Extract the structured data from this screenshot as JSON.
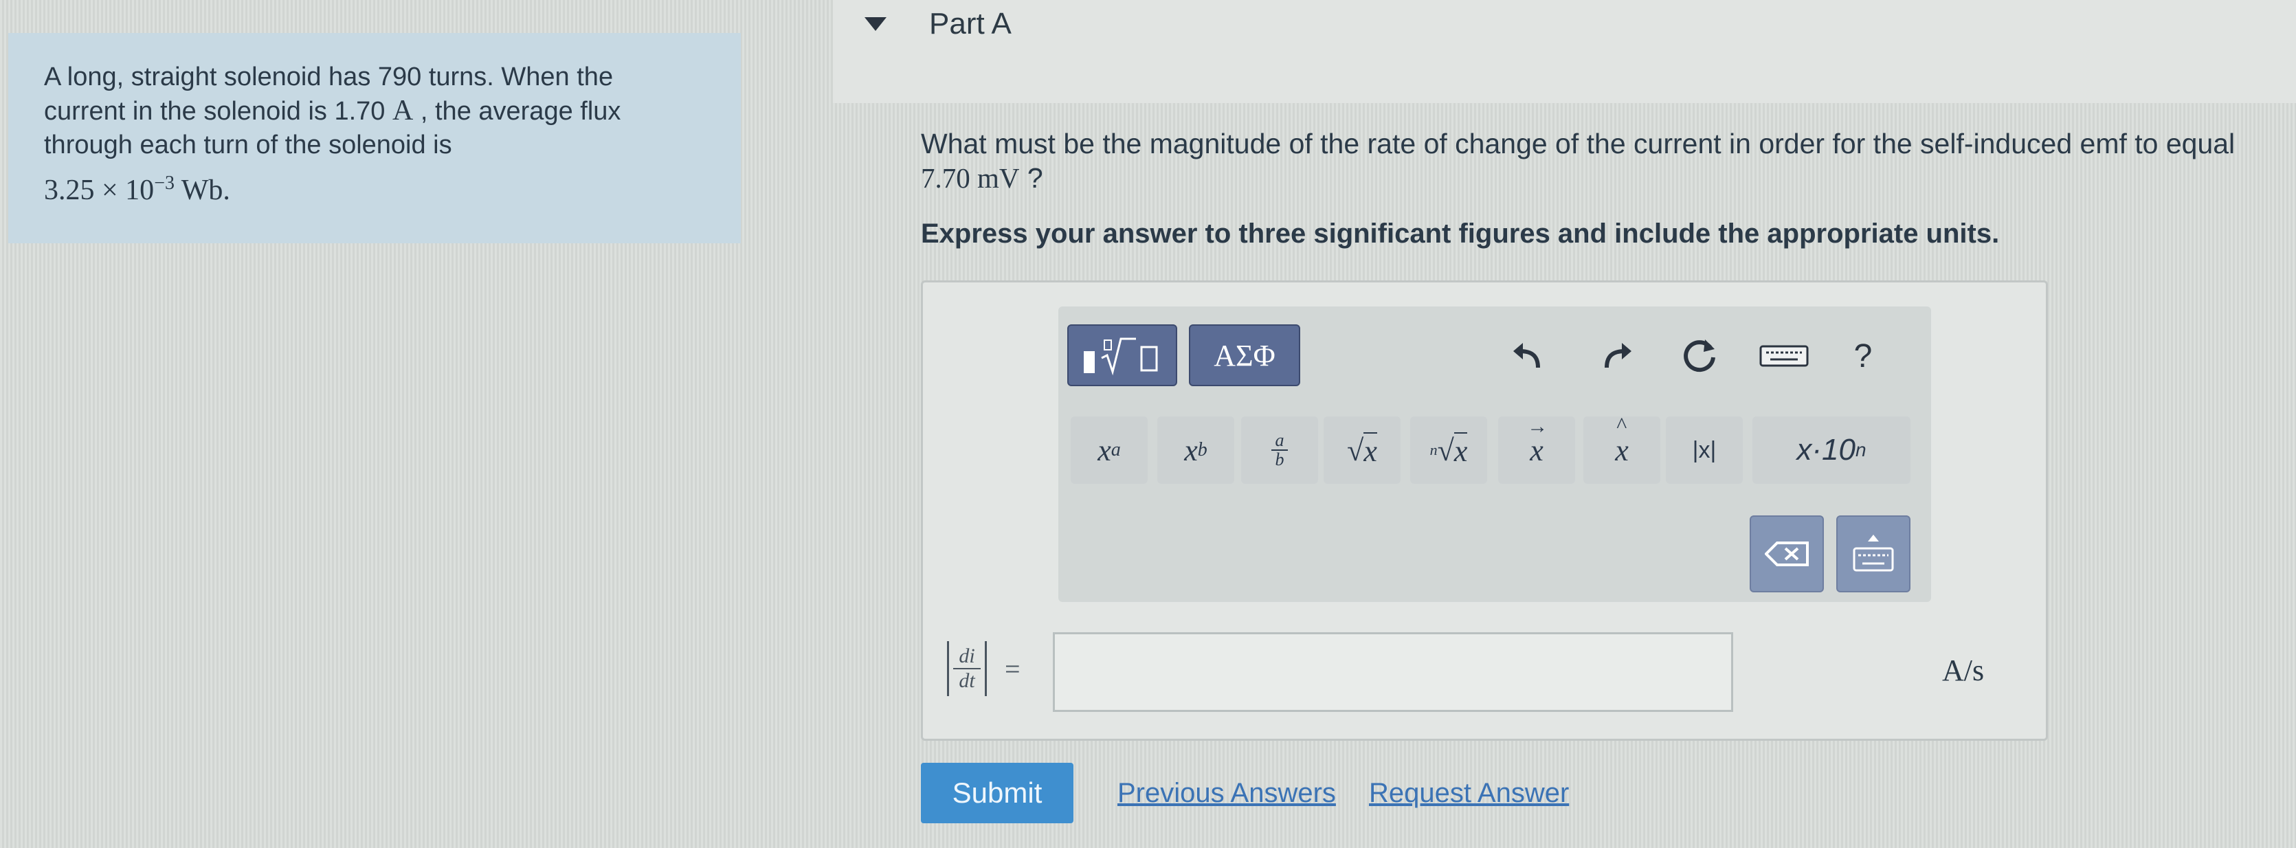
{
  "problem": {
    "line1": "A long, straight solenoid has 790 turns. When the",
    "line2_pre": "current in the solenoid is 1.70 ",
    "line2_unit": "A",
    "line2_post": " , the average flux",
    "line3": "through each turn of the solenoid is",
    "flux_mantissa": "3.25 × 10",
    "flux_exponent": "−3",
    "flux_unit": " Wb."
  },
  "part": {
    "title": "Part A",
    "question_pre": "What must be the magnitude of the rate of change of the current in order for the self-induced emf to equal",
    "question_value": "7.70 mV",
    "question_post": " ?",
    "instructions": "Express your answer to three significant figures and include the appropriate units."
  },
  "toolbar": {
    "greek_label": "ΑΣΦ",
    "help_label": "?",
    "buttons": [
      "x^a",
      "x_b",
      "a/b",
      "√x",
      "ⁿ√x",
      "x⃗",
      "x̂",
      "|x|",
      "x·10ⁿ"
    ]
  },
  "answer": {
    "label_numerator": "di",
    "label_denominator": "dt",
    "equals": "=",
    "value": "",
    "units": "A/s"
  },
  "actions": {
    "submit": "Submit",
    "previous_answers": "Previous Answers",
    "request_answer": "Request Answer"
  }
}
